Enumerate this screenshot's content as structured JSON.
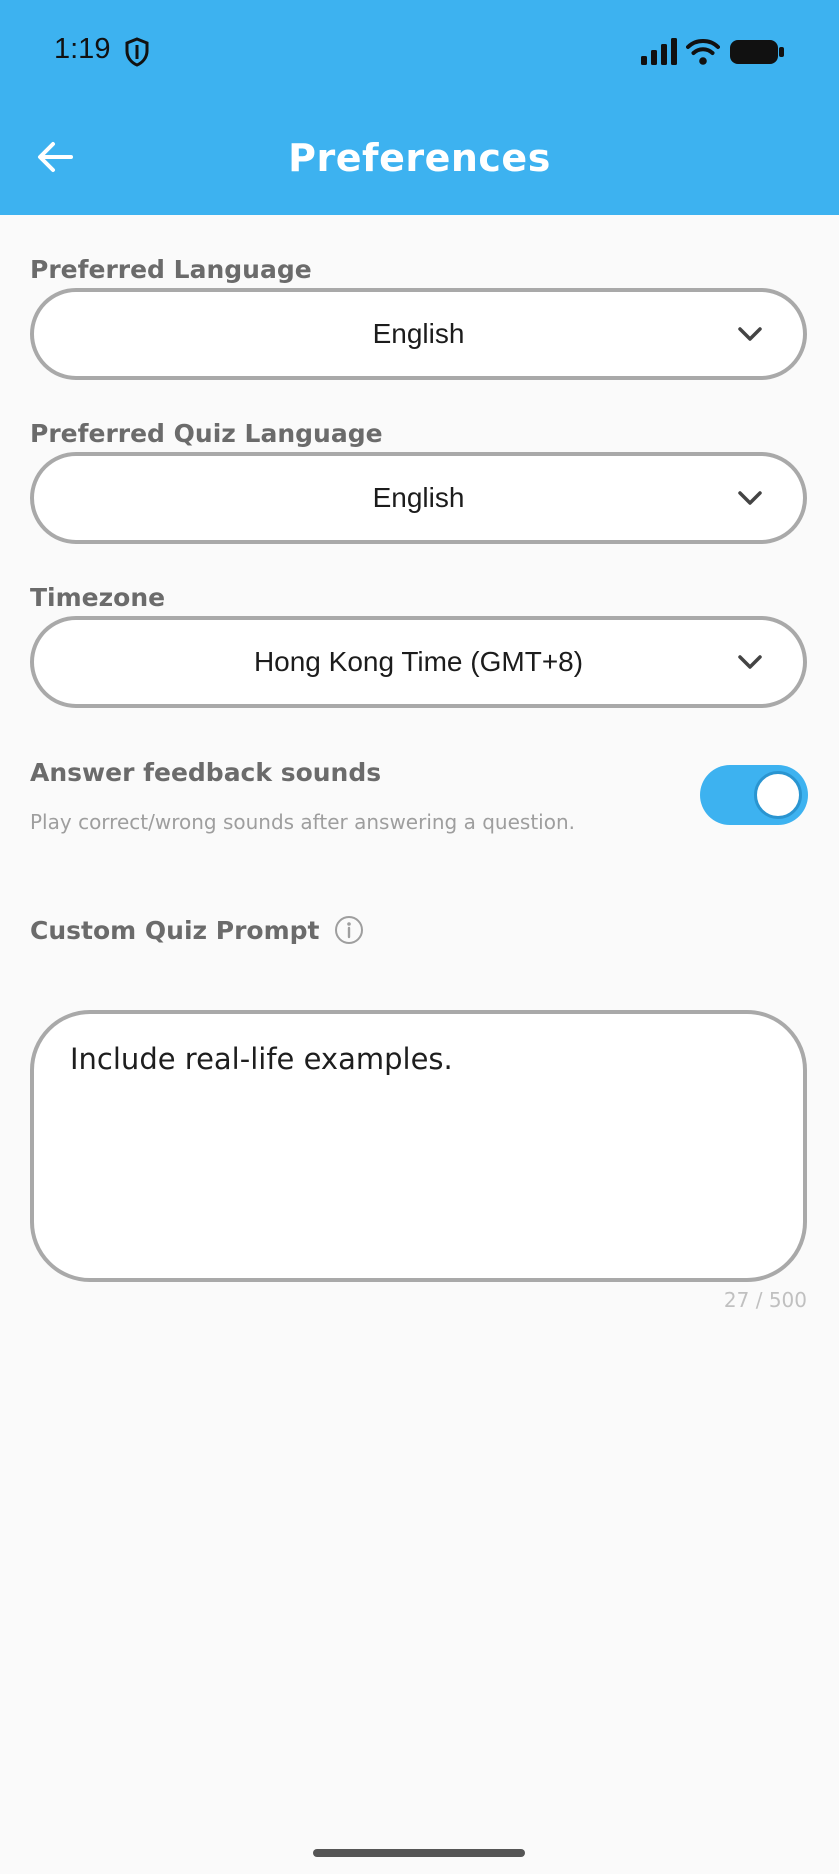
{
  "status_bar": {
    "time": "1:19",
    "icons": [
      "shield-icon",
      "signal-icon",
      "wifi-icon",
      "battery-icon"
    ]
  },
  "header": {
    "title": "Preferences",
    "back_icon": "arrow-left-icon",
    "background_color": "#3db2f0"
  },
  "fields": {
    "language": {
      "label": "Preferred Language",
      "value": "English"
    },
    "quiz_language": {
      "label": "Preferred Quiz Language",
      "value": "English"
    },
    "timezone": {
      "label": "Timezone",
      "value": "Hong Kong Time (GMT+8)"
    }
  },
  "feedback_sounds": {
    "title": "Answer feedback sounds",
    "description": "Play correct/wrong sounds after answering a question.",
    "enabled": true
  },
  "custom_prompt": {
    "label": "Custom Quiz Prompt",
    "value": "Include real-life examples.",
    "counter": "27 / 500"
  },
  "colors": {
    "accent": "#3db2f0",
    "border": "#a9a9a9",
    "label": "#6b6b6b"
  }
}
